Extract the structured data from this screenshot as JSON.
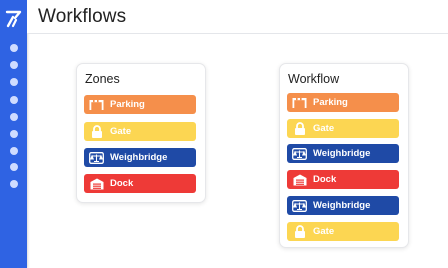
{
  "header": {
    "title": "Workflows"
  },
  "zones_card": {
    "title": "Zones",
    "items": [
      {
        "label": "Parking",
        "icon": "parking-barrier-icon",
        "color": "#f58f4b"
      },
      {
        "label": "Gate",
        "icon": "lock-icon",
        "color": "#fcd652"
      },
      {
        "label": "Weighbridge",
        "icon": "scale-icon",
        "color": "#1f4aa6"
      },
      {
        "label": "Dock",
        "icon": "warehouse-icon",
        "color": "#ee3a37"
      }
    ]
  },
  "workflow_card": {
    "title": "Workflow",
    "items": [
      {
        "label": "Parking",
        "icon": "parking-barrier-icon",
        "color": "#f58f4b"
      },
      {
        "label": "Gate",
        "icon": "lock-icon",
        "color": "#fcd652"
      },
      {
        "label": "Weighbridge",
        "icon": "scale-icon",
        "color": "#1f4aa6"
      },
      {
        "label": "Dock",
        "icon": "warehouse-icon",
        "color": "#ee3a37"
      },
      {
        "label": "Weighbridge",
        "icon": "scale-icon",
        "color": "#1f4aa6"
      },
      {
        "label": "Gate",
        "icon": "lock-icon",
        "color": "#fcd652"
      }
    ]
  },
  "sidebar": {
    "accent": "#2f63e3",
    "icon": "logo-icon"
  }
}
